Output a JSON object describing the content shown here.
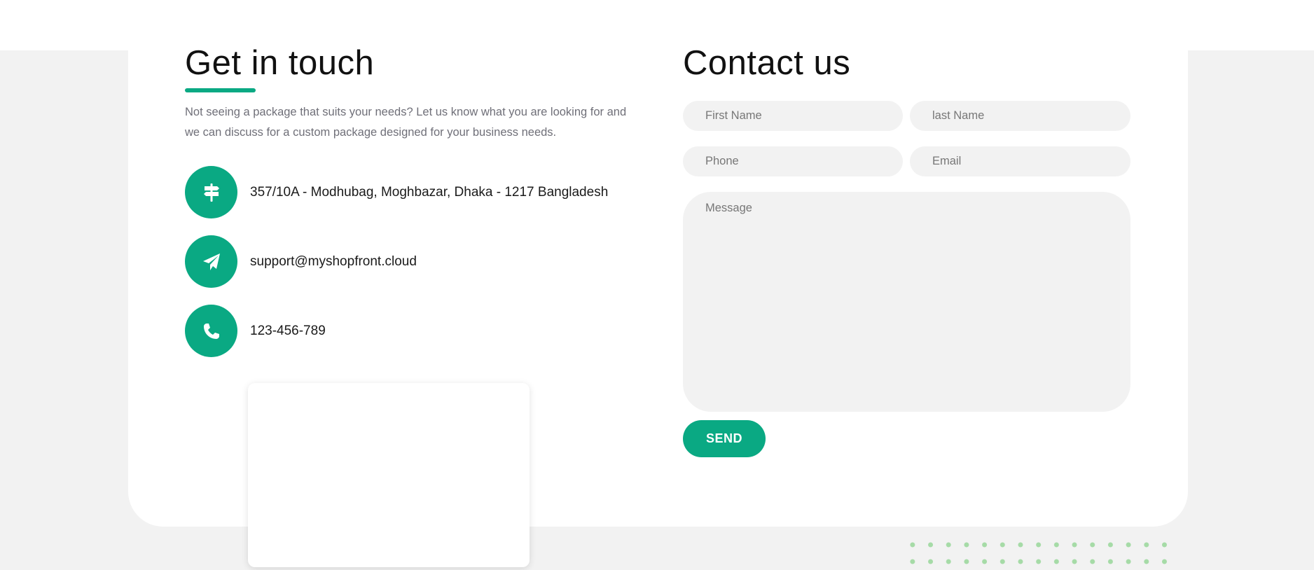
{
  "left": {
    "title": "Get in touch",
    "intro": "Not seeing a package that suits your needs? Let us know what you are looking for and we can discuss for a custom package designed for your business needs.",
    "contacts": [
      {
        "icon": "signpost-icon",
        "text": "357/10A - Modhubag, Moghbazar, Dhaka - 1217 Bangladesh"
      },
      {
        "icon": "paper-plane-icon",
        "text": "support@myshopfront.cloud"
      },
      {
        "icon": "phone-icon",
        "text": "123-456-789"
      }
    ]
  },
  "right": {
    "title": "Contact us",
    "form": {
      "first_name_placeholder": "First Name",
      "last_name_placeholder": "last Name",
      "phone_placeholder": "Phone",
      "email_placeholder": "Email",
      "message_placeholder": "Message",
      "send_label": "SEND"
    }
  },
  "colors": {
    "accent": "#0aa983",
    "page_background": "#f2f2f2",
    "field_background": "#f2f2f2",
    "dots": "#a6dba7"
  }
}
